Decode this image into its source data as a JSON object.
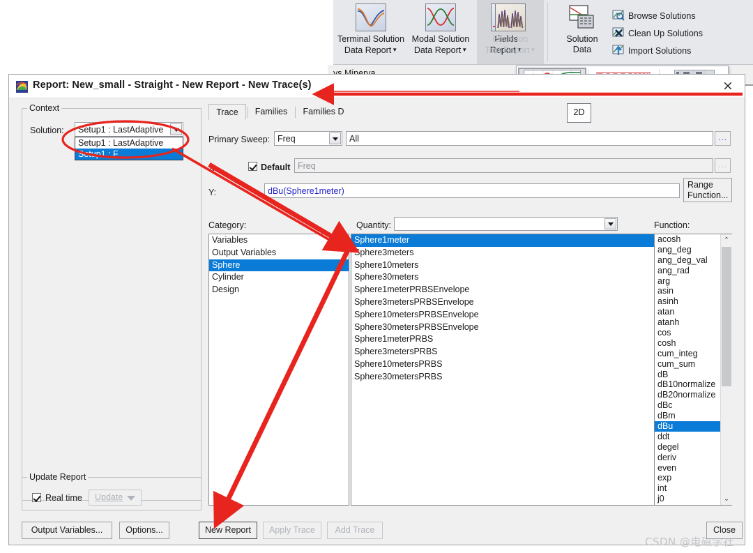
{
  "ribbon": {
    "buttons": [
      {
        "id": "terminal-solution-data-report",
        "line1": "Terminal Solution",
        "line2": "Data Report",
        "has_caret": true,
        "disabled": false
      },
      {
        "id": "modal-solution-data-report",
        "line1": "Modal Solution",
        "line2": "Data Report",
        "has_caret": true,
        "disabled": false
      },
      {
        "id": "fields-report",
        "line1": "Fields",
        "line2": "Report",
        "has_caret": true,
        "disabled": false
      },
      {
        "id": "emission-test-report",
        "line1": "Emission",
        "line2": "Test Report",
        "has_caret": true,
        "disabled": true
      },
      {
        "id": "solution-data",
        "line1": "Solution",
        "line2": "Data",
        "has_caret": false,
        "disabled": false
      }
    ],
    "small_buttons": [
      {
        "id": "browse-solutions",
        "label": "Browse Solutions"
      },
      {
        "id": "clean-up-solutions",
        "label": "Clean Up Solutions"
      },
      {
        "id": "import-solutions",
        "label": "Import Solutions"
      }
    ]
  },
  "background": {
    "strip_text": "ys Minerva"
  },
  "gallery": {
    "items": [
      {
        "id": "2d",
        "label": "2D",
        "selected": true
      },
      {
        "id": "stacked",
        "label": "Stacked",
        "selected": false
      },
      {
        "id": "data-table",
        "label": "Data Table",
        "selected": false
      }
    ],
    "tooltip": "2D"
  },
  "dialog": {
    "title": "Report: New_small - Straight - New Report - New Trace(s)",
    "close_label": "×",
    "context": {
      "legend": "Context",
      "solution_label": "Solution:",
      "solution_value": "Setup1 : LastAdaptive",
      "solution_options": [
        {
          "label": "Setup1 : LastAdaptive",
          "selected": false
        },
        {
          "label": "Setup1 : F",
          "selected": true
        }
      ]
    },
    "update_report": {
      "legend": "Update Report",
      "realtime_label": "Real time",
      "realtime_checked": true,
      "update_label": "Update"
    },
    "tabs": [
      {
        "id": "trace",
        "label": "Trace",
        "active": true
      },
      {
        "id": "families",
        "label": "Families",
        "active": false
      },
      {
        "id": "families-display",
        "label": "Families D",
        "active": false
      }
    ],
    "trace": {
      "primary_sweep_label": "Primary Sweep:",
      "primary_sweep_value": "Freq",
      "primary_sweep_range": "All",
      "primary_sweep_ellipsis": "...",
      "x_label": "X:",
      "x_default_label": "Default",
      "x_default_checked": true,
      "x_value": "Freq",
      "x_ellipsis": "...",
      "y_label": "Y:",
      "y_value": "dBu(Sphere1meter)",
      "range_function_label_line1": "Range",
      "range_function_label_line2": "Function..."
    },
    "category": {
      "label": "Category:",
      "items": [
        {
          "label": "Variables",
          "selected": false
        },
        {
          "label": "Output Variables",
          "selected": false
        },
        {
          "label": "Sphere",
          "selected": true
        },
        {
          "label": "Cylinder",
          "selected": false
        },
        {
          "label": "Design",
          "selected": false
        }
      ]
    },
    "quantity": {
      "label": "Quantity:",
      "filter_value": "",
      "items": [
        {
          "label": "Sphere1meter",
          "selected": true
        },
        {
          "label": "Sphere3meters",
          "selected": false
        },
        {
          "label": "Sphere10meters",
          "selected": false
        },
        {
          "label": "Sphere30meters",
          "selected": false
        },
        {
          "label": "Sphere1meterPRBSEnvelope",
          "selected": false
        },
        {
          "label": "Sphere3metersPRBSEnvelope",
          "selected": false
        },
        {
          "label": "Sphere10metersPRBSEnvelope",
          "selected": false
        },
        {
          "label": "Sphere30metersPRBSEnvelope",
          "selected": false
        },
        {
          "label": "Sphere1meterPRBS",
          "selected": false
        },
        {
          "label": "Sphere3metersPRBS",
          "selected": false
        },
        {
          "label": "Sphere10metersPRBS",
          "selected": false
        },
        {
          "label": "Sphere30metersPRBS",
          "selected": false
        }
      ]
    },
    "function": {
      "label": "Function:",
      "items": [
        {
          "label": "acosh",
          "selected": false
        },
        {
          "label": "ang_deg",
          "selected": false
        },
        {
          "label": "ang_deg_val",
          "selected": false
        },
        {
          "label": "ang_rad",
          "selected": false
        },
        {
          "label": "arg",
          "selected": false
        },
        {
          "label": "asin",
          "selected": false
        },
        {
          "label": "asinh",
          "selected": false
        },
        {
          "label": "atan",
          "selected": false
        },
        {
          "label": "atanh",
          "selected": false
        },
        {
          "label": "cos",
          "selected": false
        },
        {
          "label": "cosh",
          "selected": false
        },
        {
          "label": "cum_integ",
          "selected": false
        },
        {
          "label": "cum_sum",
          "selected": false
        },
        {
          "label": "dB",
          "selected": false
        },
        {
          "label": "dB10normalize",
          "selected": false
        },
        {
          "label": "dB20normalize",
          "selected": false
        },
        {
          "label": "dBc",
          "selected": false
        },
        {
          "label": "dBm",
          "selected": false
        },
        {
          "label": "dBu",
          "selected": true
        },
        {
          "label": "ddt",
          "selected": false
        },
        {
          "label": "degel",
          "selected": false
        },
        {
          "label": "deriv",
          "selected": false
        },
        {
          "label": "even",
          "selected": false
        },
        {
          "label": "exp",
          "selected": false
        },
        {
          "label": "int",
          "selected": false
        },
        {
          "label": "j0",
          "selected": false
        }
      ]
    },
    "footer_buttons": [
      {
        "id": "output-variables",
        "label": "Output Variables...",
        "disabled": false
      },
      {
        "id": "options",
        "label": "Options...",
        "disabled": false
      },
      {
        "id": "new-report",
        "label": "New Report",
        "disabled": false,
        "default": true
      },
      {
        "id": "apply-trace",
        "label": "Apply Trace",
        "disabled": true
      },
      {
        "id": "add-trace",
        "label": "Add Trace",
        "disabled": true
      },
      {
        "id": "close",
        "label": "Close",
        "disabled": false
      }
    ]
  },
  "watermark": "CSDN @电磁学社",
  "colors": {
    "selection_blue": "#0a7bd6",
    "annotation_red": "#e8241e",
    "dialog_bg": "#f0f0f0",
    "ribbon_bg": "#e7e8ec"
  }
}
